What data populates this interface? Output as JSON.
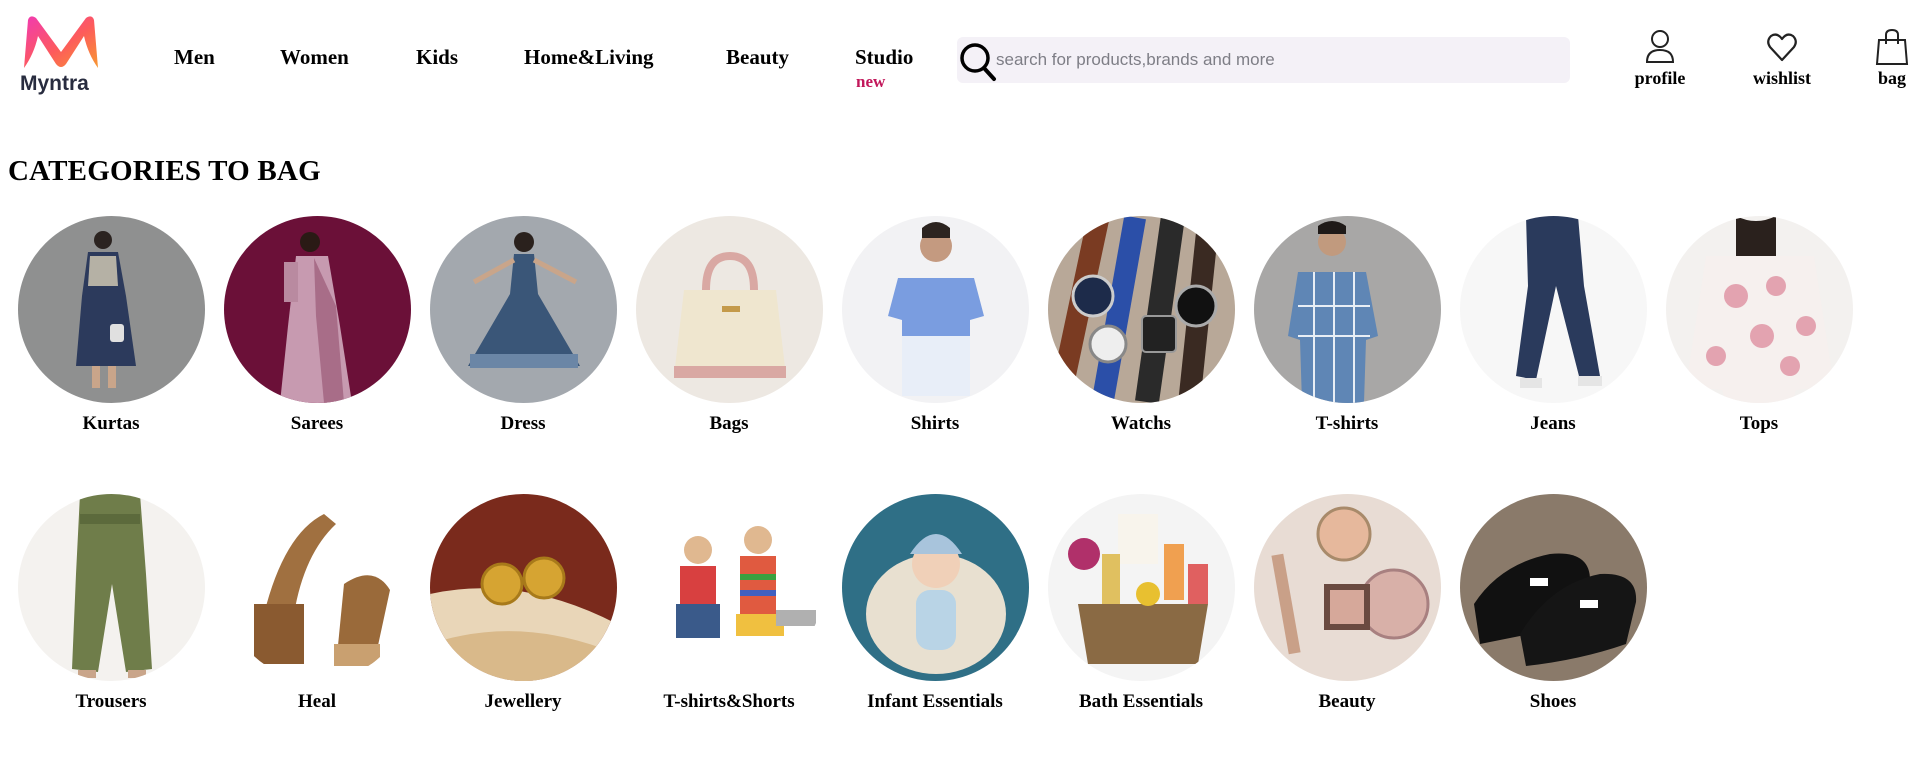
{
  "brand": {
    "name": "Myntra"
  },
  "nav": {
    "items": [
      "Men",
      "Women",
      "Kids",
      "Home&Living",
      "Beauty",
      "Studio"
    ],
    "studio_badge": "new"
  },
  "search": {
    "placeholder": "search for products,brands and more",
    "value": ""
  },
  "actions": {
    "profile": "profile",
    "wishlist": "wishlist",
    "bag": "bag"
  },
  "section": {
    "title": "CATEGORIES TO BAG"
  },
  "categories": [
    {
      "label": "Kurtas",
      "icon": "kurta-image"
    },
    {
      "label": "Sarees",
      "icon": "saree-image"
    },
    {
      "label": "Dress",
      "icon": "dress-image"
    },
    {
      "label": "Bags",
      "icon": "handbag-image"
    },
    {
      "label": "Shirts",
      "icon": "shirt-image"
    },
    {
      "label": "Watchs",
      "icon": "watch-image"
    },
    {
      "label": "T-shirts",
      "icon": "tshirt-image"
    },
    {
      "label": "Jeans",
      "icon": "jeans-image"
    },
    {
      "label": "Tops",
      "icon": "top-image"
    },
    {
      "label": "Trousers",
      "icon": "trousers-image"
    },
    {
      "label": "Heal",
      "icon": "heel-sandal-image"
    },
    {
      "label": "Jewellery",
      "icon": "earrings-image"
    },
    {
      "label": "T-shirts&Shorts",
      "icon": "kids-clothing-image"
    },
    {
      "label": "Infant Essentials",
      "icon": "infant-image"
    },
    {
      "label": "Bath Essentials",
      "icon": "bath-basket-image"
    },
    {
      "label": "Beauty",
      "icon": "makeup-image"
    },
    {
      "label": "Shoes",
      "icon": "loafer-image"
    }
  ],
  "colors": {
    "brand_pink": "#ff3f6c",
    "brand_orange": "#f79831",
    "new_badge": "#c2185b",
    "search_bg": "#f4f1f7"
  }
}
